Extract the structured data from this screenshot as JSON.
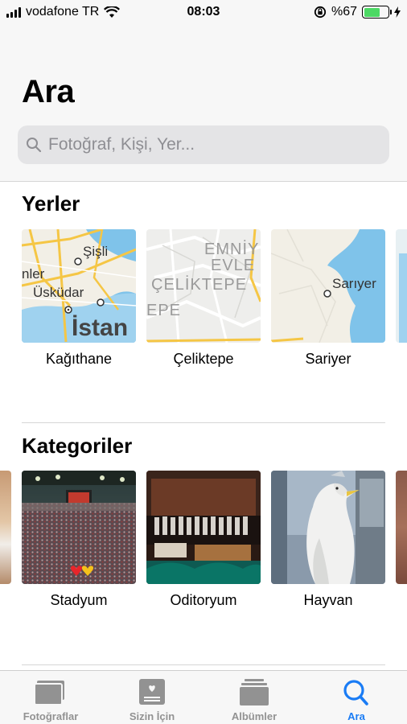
{
  "status_bar": {
    "carrier": "vodafone TR",
    "time": "08:03",
    "battery_percent": "%67",
    "battery_level": 0.67,
    "battery_color": "#4cd964"
  },
  "header": {
    "title": "Ara",
    "search_placeholder": "Fotoğraf, Kişi, Yer..."
  },
  "places": {
    "title": "Yerler",
    "items": [
      {
        "label": "Kağıthane",
        "map_labels": [
          "Şişli",
          "nler",
          "Üsküdar",
          "İstan"
        ]
      },
      {
        "label": "Çeliktepe",
        "map_labels": [
          "EMNİY",
          "EVLE",
          "ÇELİKTEPE",
          "EPE"
        ]
      },
      {
        "label": "Sariyer",
        "map_labels": [
          "Sarıyer"
        ]
      }
    ]
  },
  "categories": {
    "title": "Kategoriler",
    "items": [
      {
        "label": "Stadyum"
      },
      {
        "label": "Oditoryum"
      },
      {
        "label": "Hayvan"
      }
    ]
  },
  "tab_bar": {
    "active_color": "#1a7cf5",
    "inactive_color": "#929292",
    "tabs": [
      {
        "label": "Fotoğraflar",
        "icon": "photos-icon"
      },
      {
        "label": "Sizin İçin",
        "icon": "for-you-icon"
      },
      {
        "label": "Albümler",
        "icon": "albums-icon"
      },
      {
        "label": "Ara",
        "icon": "search-icon",
        "active": true
      }
    ]
  }
}
